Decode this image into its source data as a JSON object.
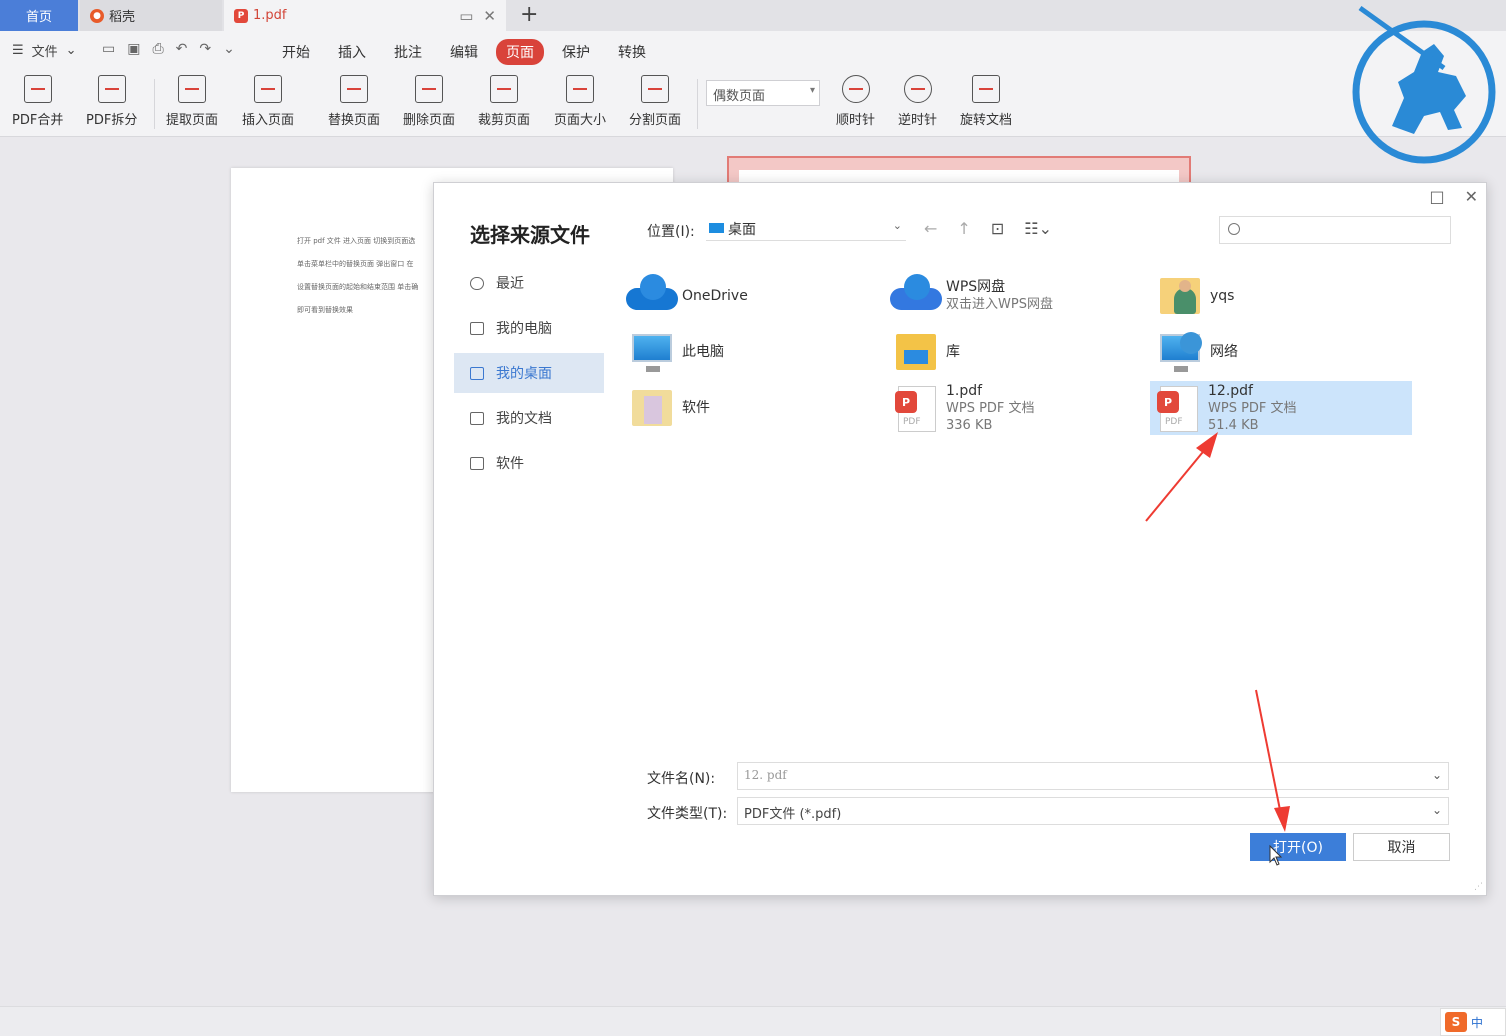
{
  "tabs": {
    "home": "首页",
    "daoke": "稻壳",
    "doc": "1.pdf"
  },
  "menubar": {
    "file": "文件",
    "items": [
      "开始",
      "插入",
      "批注",
      "编辑",
      "页面",
      "保护",
      "转换"
    ],
    "active": "页面"
  },
  "toolbar": {
    "tools": [
      "PDF合并",
      "PDF拆分",
      "提取页面",
      "插入页面",
      "替换页面",
      "删除页面",
      "裁剪页面",
      "页面大小",
      "分割页面"
    ],
    "page_select": "偶数页面",
    "rotate": [
      "顺时针",
      "逆时针",
      "旋转文档"
    ]
  },
  "document": {
    "lines": [
      "打开 pdf 文件  进入页面  切换到页面选",
      "单击菜单栏中的替换页面  弹出窗口  在",
      "设置替换页面的起始和结束范围  单击确",
      "即可看到替换效果"
    ]
  },
  "dialog": {
    "title": "选择来源文件",
    "sidebar": [
      "最近",
      "我的电脑",
      "我的桌面",
      "我的文档",
      "软件"
    ],
    "active_sidebar": "我的桌面",
    "location_label": "位置(I):",
    "location_value": "桌面",
    "items": [
      {
        "name": "OneDrive",
        "sub": "",
        "sub2": ""
      },
      {
        "name": "WPS网盘",
        "sub": "双击进入WPS网盘",
        "sub2": ""
      },
      {
        "name": "yqs",
        "sub": "",
        "sub2": ""
      },
      {
        "name": "此电脑",
        "sub": "",
        "sub2": ""
      },
      {
        "name": "库",
        "sub": "",
        "sub2": ""
      },
      {
        "name": "网络",
        "sub": "",
        "sub2": ""
      },
      {
        "name": "软件",
        "sub": "",
        "sub2": ""
      },
      {
        "name": "1.pdf",
        "sub": "WPS PDF 文档",
        "sub2": "336 KB"
      },
      {
        "name": "12.pdf",
        "sub": "WPS PDF 文档",
        "sub2": "51.4 KB"
      }
    ],
    "pdf_text": "PDF",
    "filename_label": "文件名(N):",
    "filename_value": "12. pdf",
    "filetype_label": "文件类型(T):",
    "filetype_value": "PDF文件 (*.pdf)",
    "open_button": "打开(O)",
    "cancel_button": "取消"
  },
  "ime": {
    "label": "中"
  }
}
